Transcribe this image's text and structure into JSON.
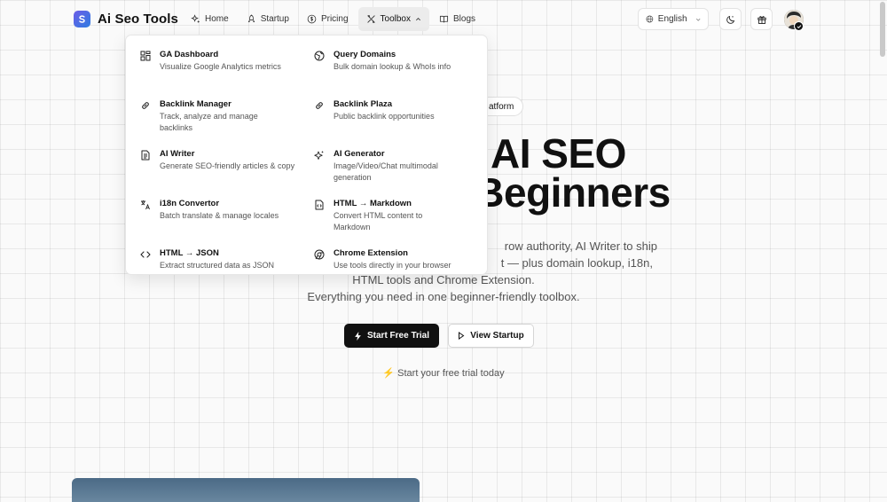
{
  "brand": {
    "name": "Ai Seo Tools"
  },
  "nav": {
    "home": "Home",
    "startup": "Startup",
    "pricing": "Pricing",
    "toolbox": "Toolbox",
    "blogs": "Blogs"
  },
  "language": {
    "selected": "English"
  },
  "hero": {
    "badge": "atform",
    "title_line1": "AI SEO",
    "title_line2": "Beginners",
    "desc_line1": "row authority, AI Writer to ship",
    "desc_line2": "t — plus domain lookup, i18n,",
    "desc_line3": "HTML tools and Chrome Extension.",
    "desc_line4": "Everything you need in one beginner-friendly toolbox.",
    "cta_primary": "Start Free Trial",
    "cta_secondary": "View Startup",
    "trial_note": "⚡ Start your free trial today"
  },
  "toolbox_menu": [
    {
      "title": "GA Dashboard",
      "desc": "Visualize Google Analytics metrics",
      "icon": "dashboard-grid-icon"
    },
    {
      "title": "Query Domains",
      "desc": "Bulk domain lookup & WhoIs info",
      "icon": "globe-icon"
    },
    {
      "title": "Backlink Manager",
      "desc": "Track, analyze and manage backlinks",
      "icon": "link-icon"
    },
    {
      "title": "Backlink Plaza",
      "desc": "Public backlink opportunities",
      "icon": "link-icon"
    },
    {
      "title": "AI Writer",
      "desc": "Generate SEO-friendly articles & copy",
      "icon": "document-icon"
    },
    {
      "title": "AI Generator",
      "desc": "Image/Video/Chat multimodal generation",
      "icon": "sparkles-icon"
    },
    {
      "title": "i18n Convertor",
      "desc": "Batch translate & manage locales",
      "icon": "translate-icon"
    },
    {
      "title": "HTML → Markdown",
      "desc": "Convert HTML content to Markdown",
      "icon": "file-code-icon"
    },
    {
      "title": "HTML → JSON",
      "desc": "Extract structured data as JSON",
      "icon": "code-brackets-icon"
    },
    {
      "title": "Chrome Extension",
      "desc": "Use tools directly in your browser",
      "icon": "chrome-icon"
    }
  ],
  "colors": {
    "primary": "#111111",
    "accent": "#6b5ce7",
    "background": "#fafafa"
  }
}
